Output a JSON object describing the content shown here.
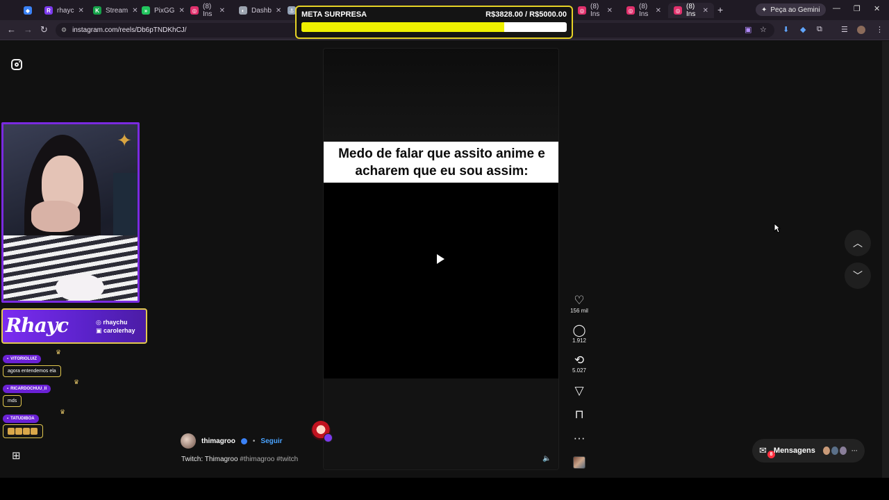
{
  "browser": {
    "tabs": [
      {
        "label": "",
        "color": "#3b82f6",
        "glyph": "◆"
      },
      {
        "label": "rhayc",
        "color": "#7c3aed",
        "glyph": "R"
      },
      {
        "label": "Stream",
        "color": "#16a34a",
        "glyph": "K"
      },
      {
        "label": "PixGG",
        "color": "#22c55e",
        "glyph": "»"
      },
      {
        "label": "(8) Ins",
        "color": "#e1306c",
        "glyph": "◎"
      },
      {
        "label": "Dashb",
        "color": "#9ca3af",
        "glyph": "◐"
      },
      {
        "label": "",
        "color": "#94a3b8",
        "glyph": "⚓"
      },
      {
        "label": "(8) Ins",
        "color": "#e1306c",
        "glyph": "◎"
      },
      {
        "label": "(8) Ins",
        "color": "#e1306c",
        "glyph": "◎"
      },
      {
        "label": "(8) Ins",
        "color": "#e1306c",
        "glyph": "◎"
      }
    ],
    "gemini_label": "Peça ao Gemini",
    "url": "instagram.com/reels/Db6pTNDKhCJ/"
  },
  "goal": {
    "title": "META SURPRESA",
    "amount": "R$3828.00 / R$5000.00",
    "progress_fraction": 0.7656
  },
  "reel": {
    "caption": "Medo de falar que assito anime e acharem que eu sou assim:",
    "creator_name": "thimagroo",
    "separator": "•",
    "follow_label": "Seguir",
    "bio_text": "Twitch: Thimagroo",
    "bio_tags": "#thimagroo #twitch"
  },
  "actions": {
    "likes": "156 mil",
    "comments": "1.912",
    "reposts": "5.027"
  },
  "messages": {
    "label": "Mensagens",
    "badge": "8"
  },
  "stream": {
    "brand": "Rhayc",
    "handle_1": "rhaychu",
    "handle_2": "carolerhay",
    "chat": [
      {
        "user": "VITORIOLUIZ",
        "message": "agora entendemos ela"
      },
      {
        "user": "RICARDOCHUU_II",
        "message": "mds"
      },
      {
        "user": "TATUDIBOA",
        "message": ""
      }
    ]
  }
}
